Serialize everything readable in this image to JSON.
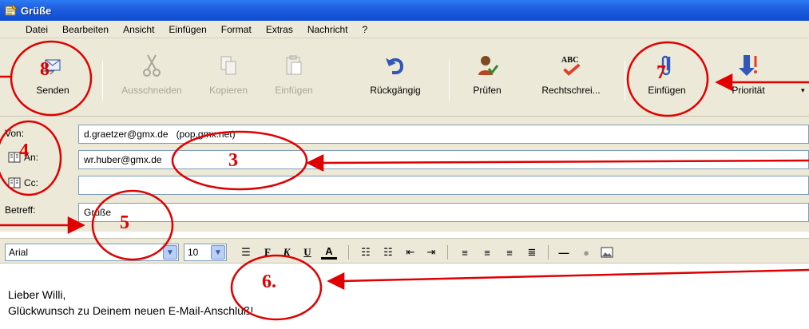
{
  "window": {
    "title": "Grüße"
  },
  "menu": [
    "Datei",
    "Bearbeiten",
    "Ansicht",
    "Einfügen",
    "Format",
    "Extras",
    "Nachricht",
    "?"
  ],
  "toolbar": {
    "send": "Senden",
    "cut": "Ausschneiden",
    "copy": "Kopieren",
    "paste": "Einfügen",
    "undo": "Rückgängig",
    "check": "Prüfen",
    "spelling": "Rechtschrei...",
    "attach": "Einfügen",
    "priority": "Priorität"
  },
  "fields": {
    "from_label": "Von:",
    "from_value": "d.graetzer@gmx.de   (pop.gmx.net)",
    "to_label": "An:",
    "to_value": "wr.huber@gmx.de",
    "cc_label": "Cc:",
    "cc_value": "",
    "subject_label": "Betreff:",
    "subject_value": "Grüße"
  },
  "format": {
    "font": "Arial",
    "size": "10"
  },
  "body": {
    "line1": "Lieber Willi,",
    "line2": "Glückwunsch zu Deinem neuen E-Mail-Anschluß!"
  },
  "annotations": [
    "8",
    "7",
    "4",
    "3",
    "5",
    "6."
  ],
  "colors": {
    "annotation": "#e00000",
    "titlebar": "#0e4cd0",
    "chrome": "#ece9d8"
  }
}
